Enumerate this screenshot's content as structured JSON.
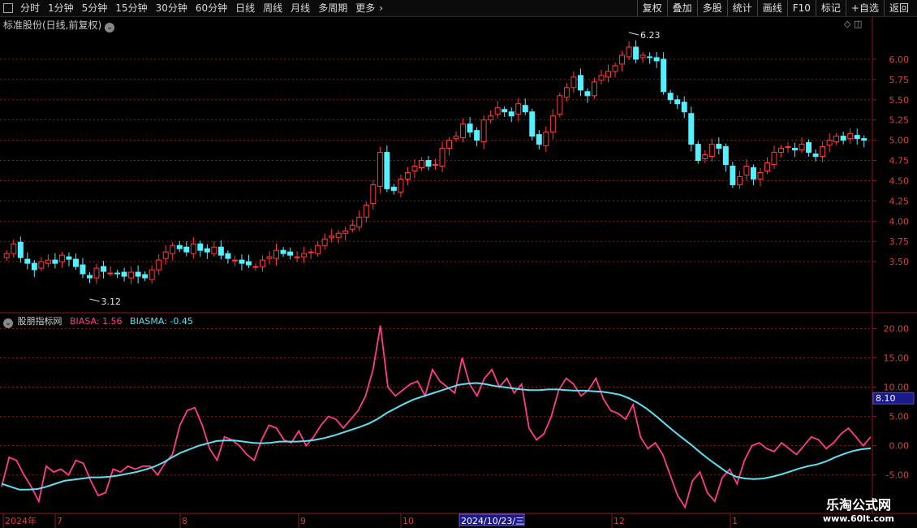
{
  "toolbar": {
    "periods": [
      "分时",
      "1分钟",
      "5分钟",
      "15分钟",
      "30分钟",
      "60分钟",
      "日线",
      "周线",
      "月线",
      "多周期",
      "更多"
    ],
    "actions": [
      "复权",
      "叠加",
      "多股",
      "统计",
      "画线",
      "F10",
      "标记",
      "+自选",
      "返回"
    ]
  },
  "main_title": "标准股份(日线,前复权)",
  "indicator": {
    "name": "股朋指标网",
    "bias_label": "BIASA: 1.56",
    "biasma_label": "BIASMA: -0.45",
    "value_badge": "8.10"
  },
  "x_axis": {
    "labels": [
      "2024年",
      "7",
      "8",
      "9",
      "10",
      "2024/10/23/三",
      "12",
      "1"
    ]
  },
  "watermark": {
    "line1": "乐淘公式网",
    "line2": "www.60lt.com"
  },
  "colors": {
    "up": "#ff3c3c",
    "down": "#54f0ff",
    "bias": "#ff3d8d",
    "biasma": "#5de0f0",
    "grid": "#8b1a1a"
  },
  "chart_data": [
    {
      "type": "candlestick",
      "yticks": [
        3.5,
        3.75,
        4.0,
        4.25,
        4.5,
        4.75,
        5.0,
        5.25,
        5.5,
        5.75,
        6.0
      ],
      "ylim": [
        3.12,
        6.23
      ],
      "annotations": [
        {
          "text": "3.12",
          "value": 3.12,
          "kind": "low"
        },
        {
          "text": "6.23",
          "value": 6.23,
          "kind": "high"
        }
      ],
      "close": [
        3.6,
        3.72,
        3.55,
        3.48,
        3.4,
        3.5,
        3.52,
        3.48,
        3.58,
        3.53,
        3.44,
        3.35,
        3.3,
        3.42,
        3.38,
        3.36,
        3.35,
        3.32,
        3.37,
        3.32,
        3.3,
        3.4,
        3.52,
        3.62,
        3.7,
        3.66,
        3.62,
        3.72,
        3.64,
        3.62,
        3.68,
        3.58,
        3.54,
        3.52,
        3.48,
        3.46,
        3.44,
        3.52,
        3.56,
        3.64,
        3.6,
        3.58,
        3.56,
        3.6,
        3.62,
        3.7,
        3.78,
        3.82,
        3.85,
        3.88,
        3.95,
        4.05,
        4.2,
        4.45,
        4.85,
        4.4,
        4.38,
        4.52,
        4.6,
        4.68,
        4.75,
        4.68,
        4.7,
        4.9,
        5.0,
        5.05,
        5.2,
        5.1,
        5.0,
        5.25,
        5.3,
        5.4,
        5.35,
        5.3,
        5.45,
        5.35,
        5.05,
        4.95,
        5.1,
        5.3,
        5.55,
        5.65,
        5.78,
        5.62,
        5.55,
        5.72,
        5.8,
        5.85,
        5.92,
        6.05,
        6.15,
        6.0,
        6.05,
        6.02,
        5.98,
        5.6,
        5.5,
        5.45,
        5.35,
        4.95,
        4.75,
        4.82,
        4.95,
        4.9,
        4.7,
        4.45,
        4.55,
        4.68,
        4.52,
        4.6,
        4.72,
        4.85,
        4.9,
        4.92,
        4.88,
        4.95,
        4.85,
        4.8,
        4.92,
        5.0,
        5.05,
        5.0,
        5.08,
        5.02,
        5.0
      ]
    },
    {
      "type": "line",
      "yticks": [
        -5.0,
        0.0,
        5.0,
        10.0,
        15.0,
        20.0
      ],
      "ylim": [
        -11,
        22
      ],
      "series": [
        {
          "name": "BIASA",
          "values": [
            -7.0,
            -2.0,
            -2.5,
            -5.0,
            -7.0,
            -9.5,
            -3.5,
            -4.5,
            -4.0,
            -5.0,
            -2.5,
            -3.0,
            -6.0,
            -8.5,
            -8.0,
            -4.0,
            -4.5,
            -3.5,
            -4.0,
            -3.5,
            -3.5,
            -5.0,
            -3.0,
            -1.5,
            3.5,
            6.0,
            6.5,
            3.5,
            -0.5,
            -2.5,
            1.5,
            1.0,
            0.0,
            -1.5,
            -2.5,
            1.0,
            3.5,
            3.0,
            1.0,
            0.5,
            2.5,
            0.0,
            1.5,
            3.5,
            5.0,
            4.5,
            3.0,
            4.5,
            6.0,
            8.5,
            13.0,
            20.5,
            10.0,
            8.5,
            9.5,
            10.5,
            11.0,
            8.5,
            13.0,
            11.0,
            10.0,
            9.0,
            15.0,
            10.5,
            8.5,
            11.5,
            13.0,
            10.0,
            11.5,
            9.0,
            10.5,
            3.0,
            1.0,
            2.0,
            5.0,
            9.5,
            11.5,
            10.5,
            8.5,
            9.5,
            11.5,
            8.0,
            6.0,
            5.5,
            4.5,
            7.0,
            1.5,
            -0.5,
            0.5,
            -1.5,
            -5.0,
            -8.5,
            -10.5,
            -6.0,
            -4.5,
            -8.0,
            -9.5,
            -5.5,
            -4.0,
            -6.5,
            -2.5,
            0.0,
            0.5,
            -0.5,
            -1.0,
            0.5,
            -0.5,
            -1.5,
            0.0,
            1.5,
            1.0,
            -0.5,
            0.5,
            2.0,
            3.0,
            1.5,
            0.0,
            1.5
          ]
        },
        {
          "name": "BIASMA",
          "values": [
            -6.5,
            -7.0,
            -7.5,
            -7.5,
            -7.4,
            -7.0,
            -6.5,
            -6.0,
            -5.8,
            -5.6,
            -5.4,
            -5.4,
            -5.3,
            -5.1,
            -4.8,
            -4.5,
            -4.1,
            -3.6,
            -2.9,
            -2.0,
            -1.2,
            -0.6,
            0.0,
            0.4,
            0.8,
            0.9,
            0.9,
            0.7,
            0.5,
            0.4,
            0.5,
            0.7,
            0.7,
            0.7,
            0.8,
            1.0,
            1.3,
            1.7,
            2.2,
            2.7,
            3.2,
            3.8,
            4.6,
            5.6,
            6.4,
            7.2,
            7.9,
            8.4,
            8.9,
            9.4,
            9.9,
            10.4,
            10.6,
            10.7,
            10.5,
            10.2,
            10.0,
            9.8,
            9.6,
            9.5,
            9.5,
            9.6,
            9.6,
            9.5,
            9.4,
            9.4,
            9.3,
            9.2,
            9.0,
            8.7,
            8.1,
            7.3,
            6.3,
            5.1,
            3.8,
            2.5,
            1.3,
            0.1,
            -1.2,
            -2.4,
            -3.5,
            -4.6,
            -5.3,
            -5.6,
            -5.7,
            -5.6,
            -5.3,
            -4.9,
            -4.4,
            -3.9,
            -3.5,
            -3.2,
            -2.7,
            -2.0,
            -1.4,
            -0.9,
            -0.6,
            -0.45
          ]
        }
      ]
    }
  ]
}
